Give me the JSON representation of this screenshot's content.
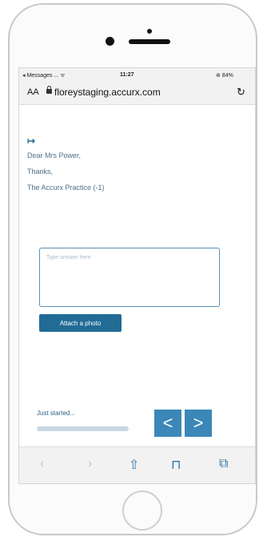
{
  "status_bar": {
    "carrier": "◂ Messages ... ᯤ",
    "time": "11:27",
    "battery": "⊛ 84%"
  },
  "browser": {
    "text_size": "AA",
    "url": "floreystaging.accurx.com",
    "reload_icon": "↻"
  },
  "message": {
    "reply_icon": "↦",
    "greeting": "Dear Mrs Power,",
    "thanks": "Thanks,",
    "signature": "The Accurx Practice (-1)"
  },
  "answer": {
    "placeholder": "Type answer here"
  },
  "attach_button": {
    "label": "Attach a photo"
  },
  "progress": {
    "label": "Just started...",
    "fraction": 0.0
  },
  "nav": {
    "prev": "<",
    "next": ">"
  },
  "toolbar": {
    "back": "‹",
    "forward": "›",
    "share": "⇧",
    "bookmarks": "⊓",
    "tabs": "⧉"
  }
}
